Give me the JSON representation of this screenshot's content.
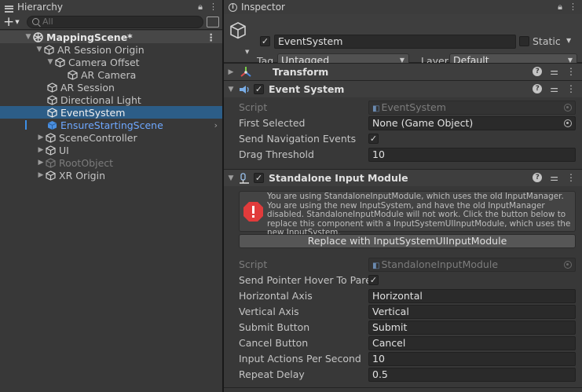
{
  "hierarchy": {
    "tab_label": "Hierarchy",
    "search_placeholder": "All",
    "add_label": "+",
    "items": [
      {
        "label": "MappingScene*"
      },
      {
        "label": "AR Session Origin"
      },
      {
        "label": "Camera Offset"
      },
      {
        "label": "AR Camera"
      },
      {
        "label": "AR Session"
      },
      {
        "label": "Directional Light"
      },
      {
        "label": "EventSystem"
      },
      {
        "label": "EnsureStartingScene"
      },
      {
        "label": "SceneController"
      },
      {
        "label": "UI"
      },
      {
        "label": "RootObject"
      },
      {
        "label": "XR Origin"
      }
    ]
  },
  "inspector": {
    "tab_label": "Inspector",
    "object_name": "EventSystem",
    "static_label": "Static",
    "tag_label": "Tag",
    "tag_value": "Untagged",
    "layer_label": "Layer",
    "layer_value": "Default",
    "components": {
      "transform": {
        "title": "Transform"
      },
      "event_system": {
        "title": "Event System",
        "props": {
          "script_label": "Script",
          "script_value": "EventSystem",
          "first_selected_label": "First Selected",
          "first_selected_value": "None (Game Object)",
          "send_nav_label": "Send Navigation Events",
          "drag_threshold_label": "Drag Threshold",
          "drag_threshold_value": "10"
        }
      },
      "standalone_input": {
        "title": "Standalone Input Module",
        "warning": "You are using StandaloneInputModule, which uses the old InputManager. You are using the new InputSystem, and have the old InputManager disabled. StandaloneInputModule will not work. Click the button below to replace this component with a InputSystemUIInputModule, which uses the new InputSystem.",
        "replace_button": "Replace with InputSystemUIInputModule",
        "props": {
          "script_label": "Script",
          "script_value": "StandaloneInputModule",
          "hover_label": "Send Pointer Hover To Paren",
          "horizontal_label": "Horizontal Axis",
          "horizontal_value": "Horizontal",
          "vertical_label": "Vertical Axis",
          "vertical_value": "Vertical",
          "submit_label": "Submit Button",
          "submit_value": "Submit",
          "cancel_label": "Cancel Button",
          "cancel_value": "Cancel",
          "ips_label": "Input Actions Per Second",
          "ips_value": "10",
          "repeat_label": "Repeat Delay",
          "repeat_value": "0.5"
        }
      }
    }
  },
  "colors": {
    "selection": "#2c5d87",
    "prefab_text": "#6ea8ff",
    "panel_bg": "#383838",
    "error_red": "#e13b3b"
  },
  "icons": [
    "hierarchy-lines-icon",
    "lock-icon",
    "kebab-menu-icon",
    "search-icon",
    "scene-filter-icon",
    "unity-scene-icon",
    "gameobject-cube-icon",
    "prefab-cube-icon",
    "info-icon",
    "transform-axes-icon",
    "event-system-icon",
    "input-module-icon",
    "help-icon",
    "preset-sliders-icon",
    "error-icon",
    "object-picker-icon"
  ]
}
